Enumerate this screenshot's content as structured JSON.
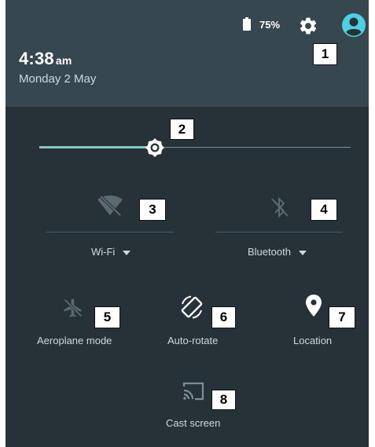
{
  "status": {
    "battery_percent": "75%",
    "time": "4:38",
    "ampm": "am",
    "date": "Monday 2 May"
  },
  "icons": {
    "battery": "battery-icon",
    "settings": "gear-icon",
    "user": "account-circle-icon",
    "brightness": "brightness-icon",
    "wifi": "wifi-off-icon",
    "bluetooth": "bluetooth-off-icon",
    "airplane": "airplane-icon",
    "rotate": "screen-rotation-icon",
    "location": "location-pin-icon",
    "cast": "cast-icon",
    "dropdown": "triangle-down-icon"
  },
  "brightness": {
    "level": 0.38
  },
  "tiles": {
    "wifi_label": "Wi-Fi",
    "bluetooth_label": "Bluetooth",
    "aeroplane_label": "Aeroplane mode",
    "autorotate_label": "Auto-rotate",
    "location_label": "Location",
    "cast_label": "Cast screen"
  },
  "annotations": [
    "1",
    "2",
    "3",
    "4",
    "5",
    "6",
    "7",
    "8"
  ],
  "colors": {
    "panel": "#263238",
    "header": "#37474f",
    "accent": "#80cbc4",
    "user_icon": "#4dd0e1"
  }
}
